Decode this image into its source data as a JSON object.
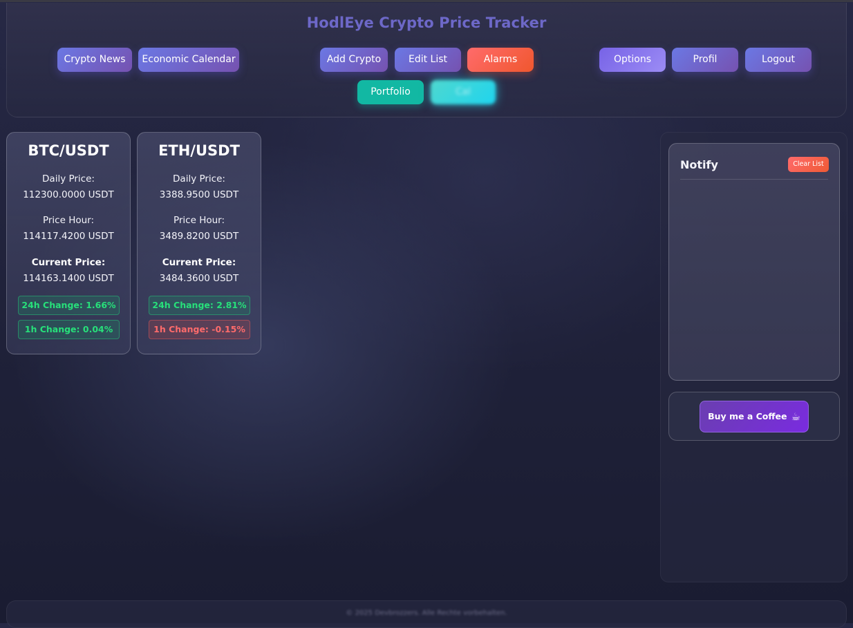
{
  "header": {
    "title": "HodlEye Crypto Price Tracker",
    "nav_left": [
      "Crypto News",
      "Economic Calendar"
    ],
    "nav_center": [
      "Add Crypto",
      "Edit List",
      "Alarms"
    ],
    "nav_right": [
      "Options",
      "Profil",
      "Logout"
    ],
    "portfolio_label": "Portfolio",
    "blurred_button_label": "Cal"
  },
  "cards": [
    {
      "pair": "BTC/USDT",
      "daily_label": "Daily Price:",
      "daily_value": "112300.0000 USDT",
      "hour_label": "Price Hour:",
      "hour_value": "114117.4200 USDT",
      "current_label": "Current Price:",
      "current_value": "114163.1400 USDT",
      "change_24h": "24h Change: 1.66%",
      "change_1h": "1h Change: 0.04%"
    },
    {
      "pair": "ETH/USDT",
      "daily_label": "Daily Price:",
      "daily_value": "3388.9500 USDT",
      "hour_label": "Price Hour:",
      "hour_value": "3489.8200 USDT",
      "current_label": "Current Price:",
      "current_value": "3484.3600 USDT",
      "change_24h": "24h Change: 2.81%",
      "change_1h": "1h Change: -0.15%"
    }
  ],
  "notify": {
    "title": "Notify",
    "clear_label": "Clear List"
  },
  "coffee": {
    "label": "Buy me a Coffee",
    "icon": "☕"
  },
  "footer": {
    "text": "© 2025 Devbrozzers. Alle Rechte vorbehalten."
  },
  "colors": {
    "accent_purple": "#6d68c8",
    "alarm_red": "#f0572e",
    "portfolio_teal": "#12b8a3",
    "positive_green": "#27e07a",
    "negative_red": "#ff6b6b"
  }
}
